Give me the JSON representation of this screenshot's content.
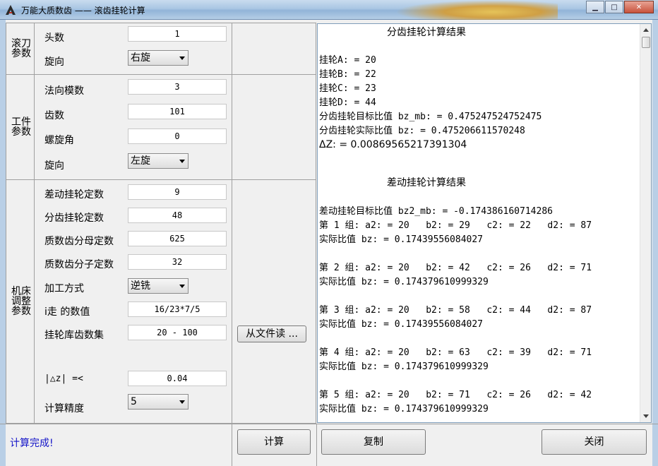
{
  "window": {
    "title": "万能大质数齿 —— 滚齿挂轮计算",
    "minimize": "▁",
    "maximize": "□",
    "close": "✕"
  },
  "hob_group": {
    "label": "滚刀参数",
    "heads_label": "头数",
    "heads_value": "1",
    "direction_label": "旋向",
    "direction_value": "右旋"
  },
  "workpiece_group": {
    "label": "工件参数",
    "module_label": "法向模数",
    "module_value": "3",
    "teeth_label": "齿数",
    "teeth_value": "101",
    "helix_label": "螺旋角",
    "helix_value": "0",
    "direction_label": "旋向",
    "direction_value": "左旋"
  },
  "machine_group": {
    "label": "机床调整参数",
    "diff_const_label": "差动挂轮定数",
    "diff_const_value": "9",
    "index_const_label": "分齿挂轮定数",
    "index_const_value": "48",
    "prime_den_label": "质数齿分母定数",
    "prime_den_value": "625",
    "prime_num_label": "质数齿分子定数",
    "prime_num_value": "32",
    "method_label": "加工方式",
    "method_value": "逆铣",
    "i_label": "i走 的数值",
    "i_value": "16/23*7/5",
    "gear_set_label": "挂轮库齿数集",
    "gear_set_value": "20 - 100",
    "read_file_button": "从文件读 ...",
    "tol_label": "|△z| =<",
    "tol_value": "0.04",
    "precision_label": "计算精度",
    "precision_value": "5"
  },
  "buttons": {
    "calculate": "计算",
    "copy": "复制",
    "close": "关闭"
  },
  "status": "计算完成!",
  "result": {
    "index_title": "分齿挂轮计算结果",
    "index_lines": [
      "挂轮A: = 20",
      "挂轮B: = 22",
      "挂轮C: = 23",
      "挂轮D: = 44",
      "分齿挂轮目标比值 bz_mb: = 0.475247524752475",
      "分齿挂轮实际比值 bz: = 0.475206611570248"
    ],
    "delta_line": "ΔZ: = 0.00869565217391304",
    "diff_title": "差动挂轮计算结果",
    "diff_target": "差动挂轮目标比值 bz2_mb: = -0.174386160714286",
    "groups": [
      {
        "line": "第 1 组: a2: = 20   b2: = 29   c2: = 22   d2: = 87",
        "actual": "实际比值 bz: = 0.17439556084027"
      },
      {
        "line": "第 2 组: a2: = 20   b2: = 42   c2: = 26   d2: = 71",
        "actual": "实际比值 bz: = 0.174379610999329"
      },
      {
        "line": "第 3 组: a2: = 20   b2: = 58   c2: = 44   d2: = 87",
        "actual": "实际比值 bz: = 0.17439556084027"
      },
      {
        "line": "第 4 组: a2: = 20   b2: = 63   c2: = 39   d2: = 71",
        "actual": "实际比值 bz: = 0.174379610999329"
      },
      {
        "line": "第 5 组: a2: = 20   b2: = 71   c2: = 26   d2: = 42",
        "actual": "实际比值 bz: = 0.174379610999329"
      }
    ]
  }
}
